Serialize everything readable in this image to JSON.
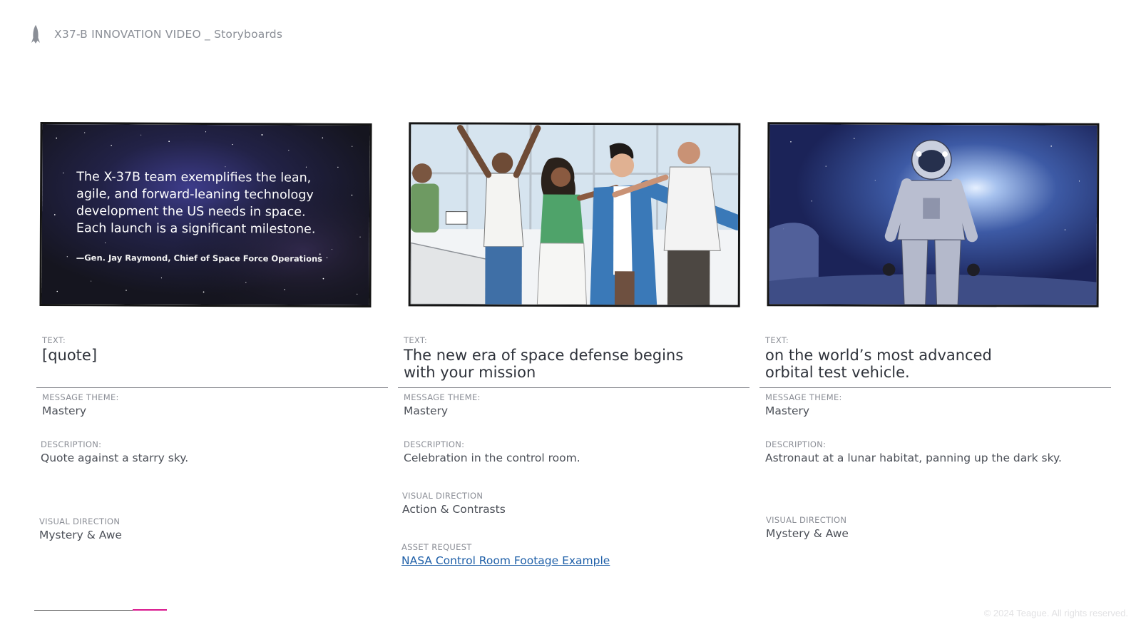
{
  "header": {
    "title": "X37-B INNOVATION VIDEO _ Storyboards",
    "icon": "rocket-icon"
  },
  "panels": [
    {
      "scene": "starry-sky",
      "quote": "The X-37B team exemplifies the lean, agile, and forward-leaning technology development the US needs in space. Each launch is a significant milestone.",
      "attribution": "—Gen. Jay Raymond, Chief of Space Force Operations"
    },
    {
      "scene": "control-room-celebration"
    },
    {
      "scene": "astronaut-lunar"
    }
  ],
  "columns": [
    {
      "text_label": "TEXT:",
      "text": "[quote]",
      "theme_label": "MESSAGE THEME:",
      "theme": "Mastery",
      "description_label": "DESCRIPTION:",
      "description": "Quote against a starry sky.",
      "visual_label": "VISUAL DIRECTION",
      "visual": "Mystery & Awe"
    },
    {
      "text_label": "TEXT:",
      "text": "The new era of space defense begins\nwith your mission",
      "theme_label": "MESSAGE THEME:",
      "theme": "Mastery",
      "description_label": "DESCRIPTION:",
      "description": "Celebration in the control room.",
      "visual_label": "VISUAL DIRECTION",
      "visual": "Action & Contrasts",
      "asset_label": "ASSET REQUEST",
      "asset_link": "NASA Control Room Footage Example"
    },
    {
      "text_label": "TEXT:",
      "text": "on the world’s most advanced\norbital test vehicle.",
      "theme_label": "MESSAGE THEME:",
      "theme": "Mastery",
      "description_label": "DESCRIPTION:",
      "description": "Astronaut at a lunar habitat, panning up the dark sky.",
      "visual_label": "VISUAL DIRECTION",
      "visual": "Mystery & Awe"
    }
  ],
  "footer": {
    "copyright": "© 2024 Teague. All rights reserved.",
    "accent_color": "#d9168d"
  },
  "colors": {
    "link": "#1e5fa8",
    "label": "#8b8e96",
    "text": "#2f333b"
  }
}
